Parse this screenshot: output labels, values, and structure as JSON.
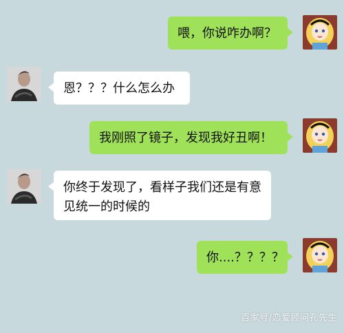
{
  "messages": [
    {
      "side": "right",
      "avatar": "alice-avatar",
      "text": "喂，你说咋办啊？"
    },
    {
      "side": "left",
      "avatar": "man-avatar",
      "text": "恩？？？什么怎么办"
    },
    {
      "side": "right",
      "avatar": "alice-avatar",
      "text": "我刚照了镜子，发现我好丑啊！"
    },
    {
      "side": "left",
      "avatar": "man-avatar",
      "text": "你终于发现了，看样子我们还是有意见统一的时候的"
    },
    {
      "side": "right",
      "avatar": "alice-avatar",
      "text": "你....？？？？"
    }
  ],
  "watermark": "百家号/恋爱顾问孔先生",
  "colors": {
    "background": "#c8d9de",
    "sent_bubble": "#9fe159",
    "received_bubble": "#ffffff"
  }
}
